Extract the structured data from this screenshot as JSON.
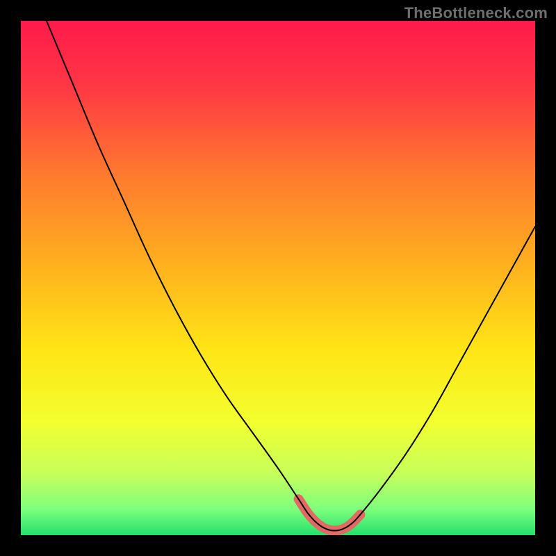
{
  "watermark": "TheBottleneck.com",
  "chart_data": {
    "type": "line",
    "title": "",
    "xlabel": "",
    "ylabel": "",
    "xlim": [
      0,
      100
    ],
    "ylim": [
      0,
      100
    ],
    "grid": false,
    "legend": false,
    "series": [
      {
        "name": "bottleneck-curve",
        "x": [
          5,
          10,
          15,
          20,
          25,
          30,
          35,
          40,
          45,
          50,
          54,
          56,
          58,
          60,
          62,
          64,
          66,
          70,
          75,
          80,
          85,
          90,
          95,
          100
        ],
        "y": [
          100,
          88,
          76,
          65,
          54,
          44,
          35,
          27,
          20,
          13,
          7,
          4,
          2,
          1,
          1,
          2,
          4,
          9,
          16,
          24,
          33,
          42,
          51,
          60
        ]
      },
      {
        "name": "highlight-band",
        "x": [
          54,
          56,
          58,
          60,
          62,
          64,
          66
        ],
        "y": [
          7,
          4,
          2,
          1,
          1,
          2,
          4
        ]
      }
    ],
    "gradient_stops": [
      {
        "offset": 0.0,
        "color": "#ff1a4b"
      },
      {
        "offset": 0.12,
        "color": "#ff3545"
      },
      {
        "offset": 0.3,
        "color": "#ff7a2f"
      },
      {
        "offset": 0.48,
        "color": "#ffb21e"
      },
      {
        "offset": 0.64,
        "color": "#ffe516"
      },
      {
        "offset": 0.78,
        "color": "#f3ff2f"
      },
      {
        "offset": 0.88,
        "color": "#c7ff5a"
      },
      {
        "offset": 0.95,
        "color": "#7dff7d"
      },
      {
        "offset": 1.0,
        "color": "#22e06b"
      }
    ],
    "curve_color": "#000000",
    "highlight_color": "#e26a63",
    "highlight_width": 14
  }
}
